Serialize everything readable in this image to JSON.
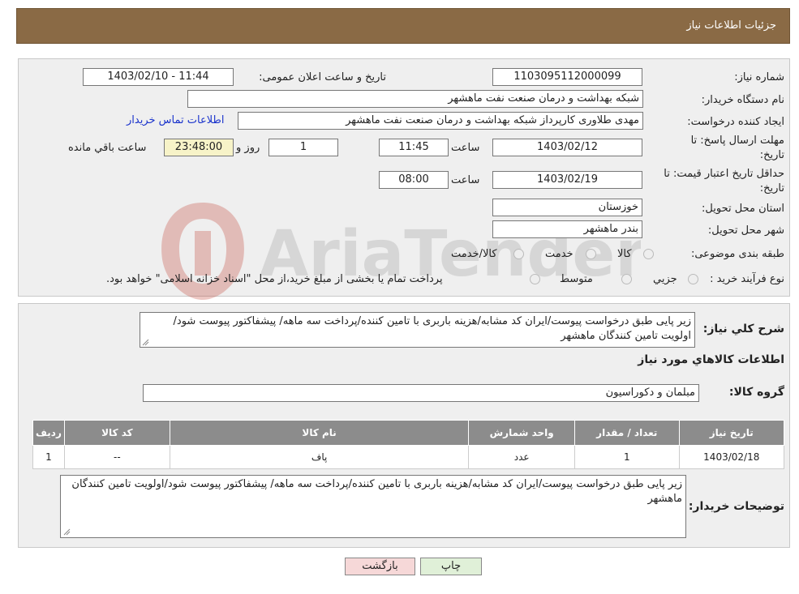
{
  "header": {
    "title": "جزئیات اطلاعات نیاز"
  },
  "form": {
    "need_number_label": "شماره نیاز:",
    "need_number": "1103095112000099",
    "announce_label": "تاریخ و ساعت اعلان عمومی:",
    "announce_value": "1403/02/10 - 11:44",
    "buyer_org_label": "نام دستگاه خریدار:",
    "buyer_org": "شبکه بهداشت و درمان صنعت نفت ماهشهر",
    "creator_label": "ایجاد کننده درخواست:",
    "creator": "مهدی طلاوری کارپرداز شبکه بهداشت و درمان صنعت نفت ماهشهر",
    "contact_link": "اطلاعات تماس خریدار",
    "deadline_label_1": "مهلت ارسال پاسخ: تا",
    "deadline_label_2": "تاریخ:",
    "deadline_date": "1403/02/12",
    "time_label": "ساعت",
    "deadline_time": "11:45",
    "days_value": "1",
    "days_label": "روز و",
    "remaining_value": "23:48:00",
    "remaining_label": "ساعت باقي مانده",
    "validity_label_1": "حداقل تاریخ اعتبار قیمت: تا",
    "validity_label_2": "تاریخ:",
    "validity_date": "1403/02/19",
    "validity_time": "08:00",
    "province_label": "استان محل تحویل:",
    "province": "خوزستان",
    "city_label": "شهر محل تحویل:",
    "city": "بندر ماهشهر",
    "category_label": "طبقه بندی موضوعی:",
    "category_options": [
      "کالا",
      "خدمت",
      "کالا/خدمت"
    ],
    "purchase_type_label": "نوع فرآیند خرید :",
    "purchase_options": [
      "جزیي",
      "متوسط"
    ],
    "purchase_note": "پرداخت تمام یا بخشی از مبلغ خرید،از محل \"اسناد خزانه اسلامی\" خواهد بود."
  },
  "summary": {
    "description_label": "شرح کلي نیاز:",
    "description": "زیر پایی طبق درخواست پیوست/ایران کد مشابه/هزینه باربری با تامین کننده/پرداخت سه ماهه/ پیشفاکتور پیوست شود/اولویت تامین کنندگان ماهشهر",
    "items_heading": "اطلاعات کالاهاي مورد نیاز",
    "group_label": "گروه کالا:",
    "group_value": "مبلمان و دکوراسیون"
  },
  "table": {
    "headers": [
      "ردیف",
      "کد کالا",
      "نام کالا",
      "واحد شمارش",
      "تعداد / مقدار",
      "تاریخ نیاز"
    ],
    "rows": [
      [
        "1",
        "--",
        "پاف",
        "عدد",
        "1",
        "1403/02/18"
      ]
    ]
  },
  "notes": {
    "label": "توضیحات خریدار:",
    "value": "زیر پایی طبق درخواست پیوست/ایران کد مشابه/هزینه باربری با تامین کننده/پرداخت سه ماهه/ پیشفاکتور پیوست شود/اولویت تامین کنندگان ماهشهر"
  },
  "buttons": {
    "print": "چاپ",
    "back": "بازگشت"
  },
  "watermark": {
    "text": "AriaTender.neT"
  },
  "colors": {
    "header": "#8a6a45",
    "link": "#1a33cc",
    "table_header": "#8c8c8c",
    "back_button": "#f6d8d8",
    "print_button": "#e0f0d8"
  }
}
